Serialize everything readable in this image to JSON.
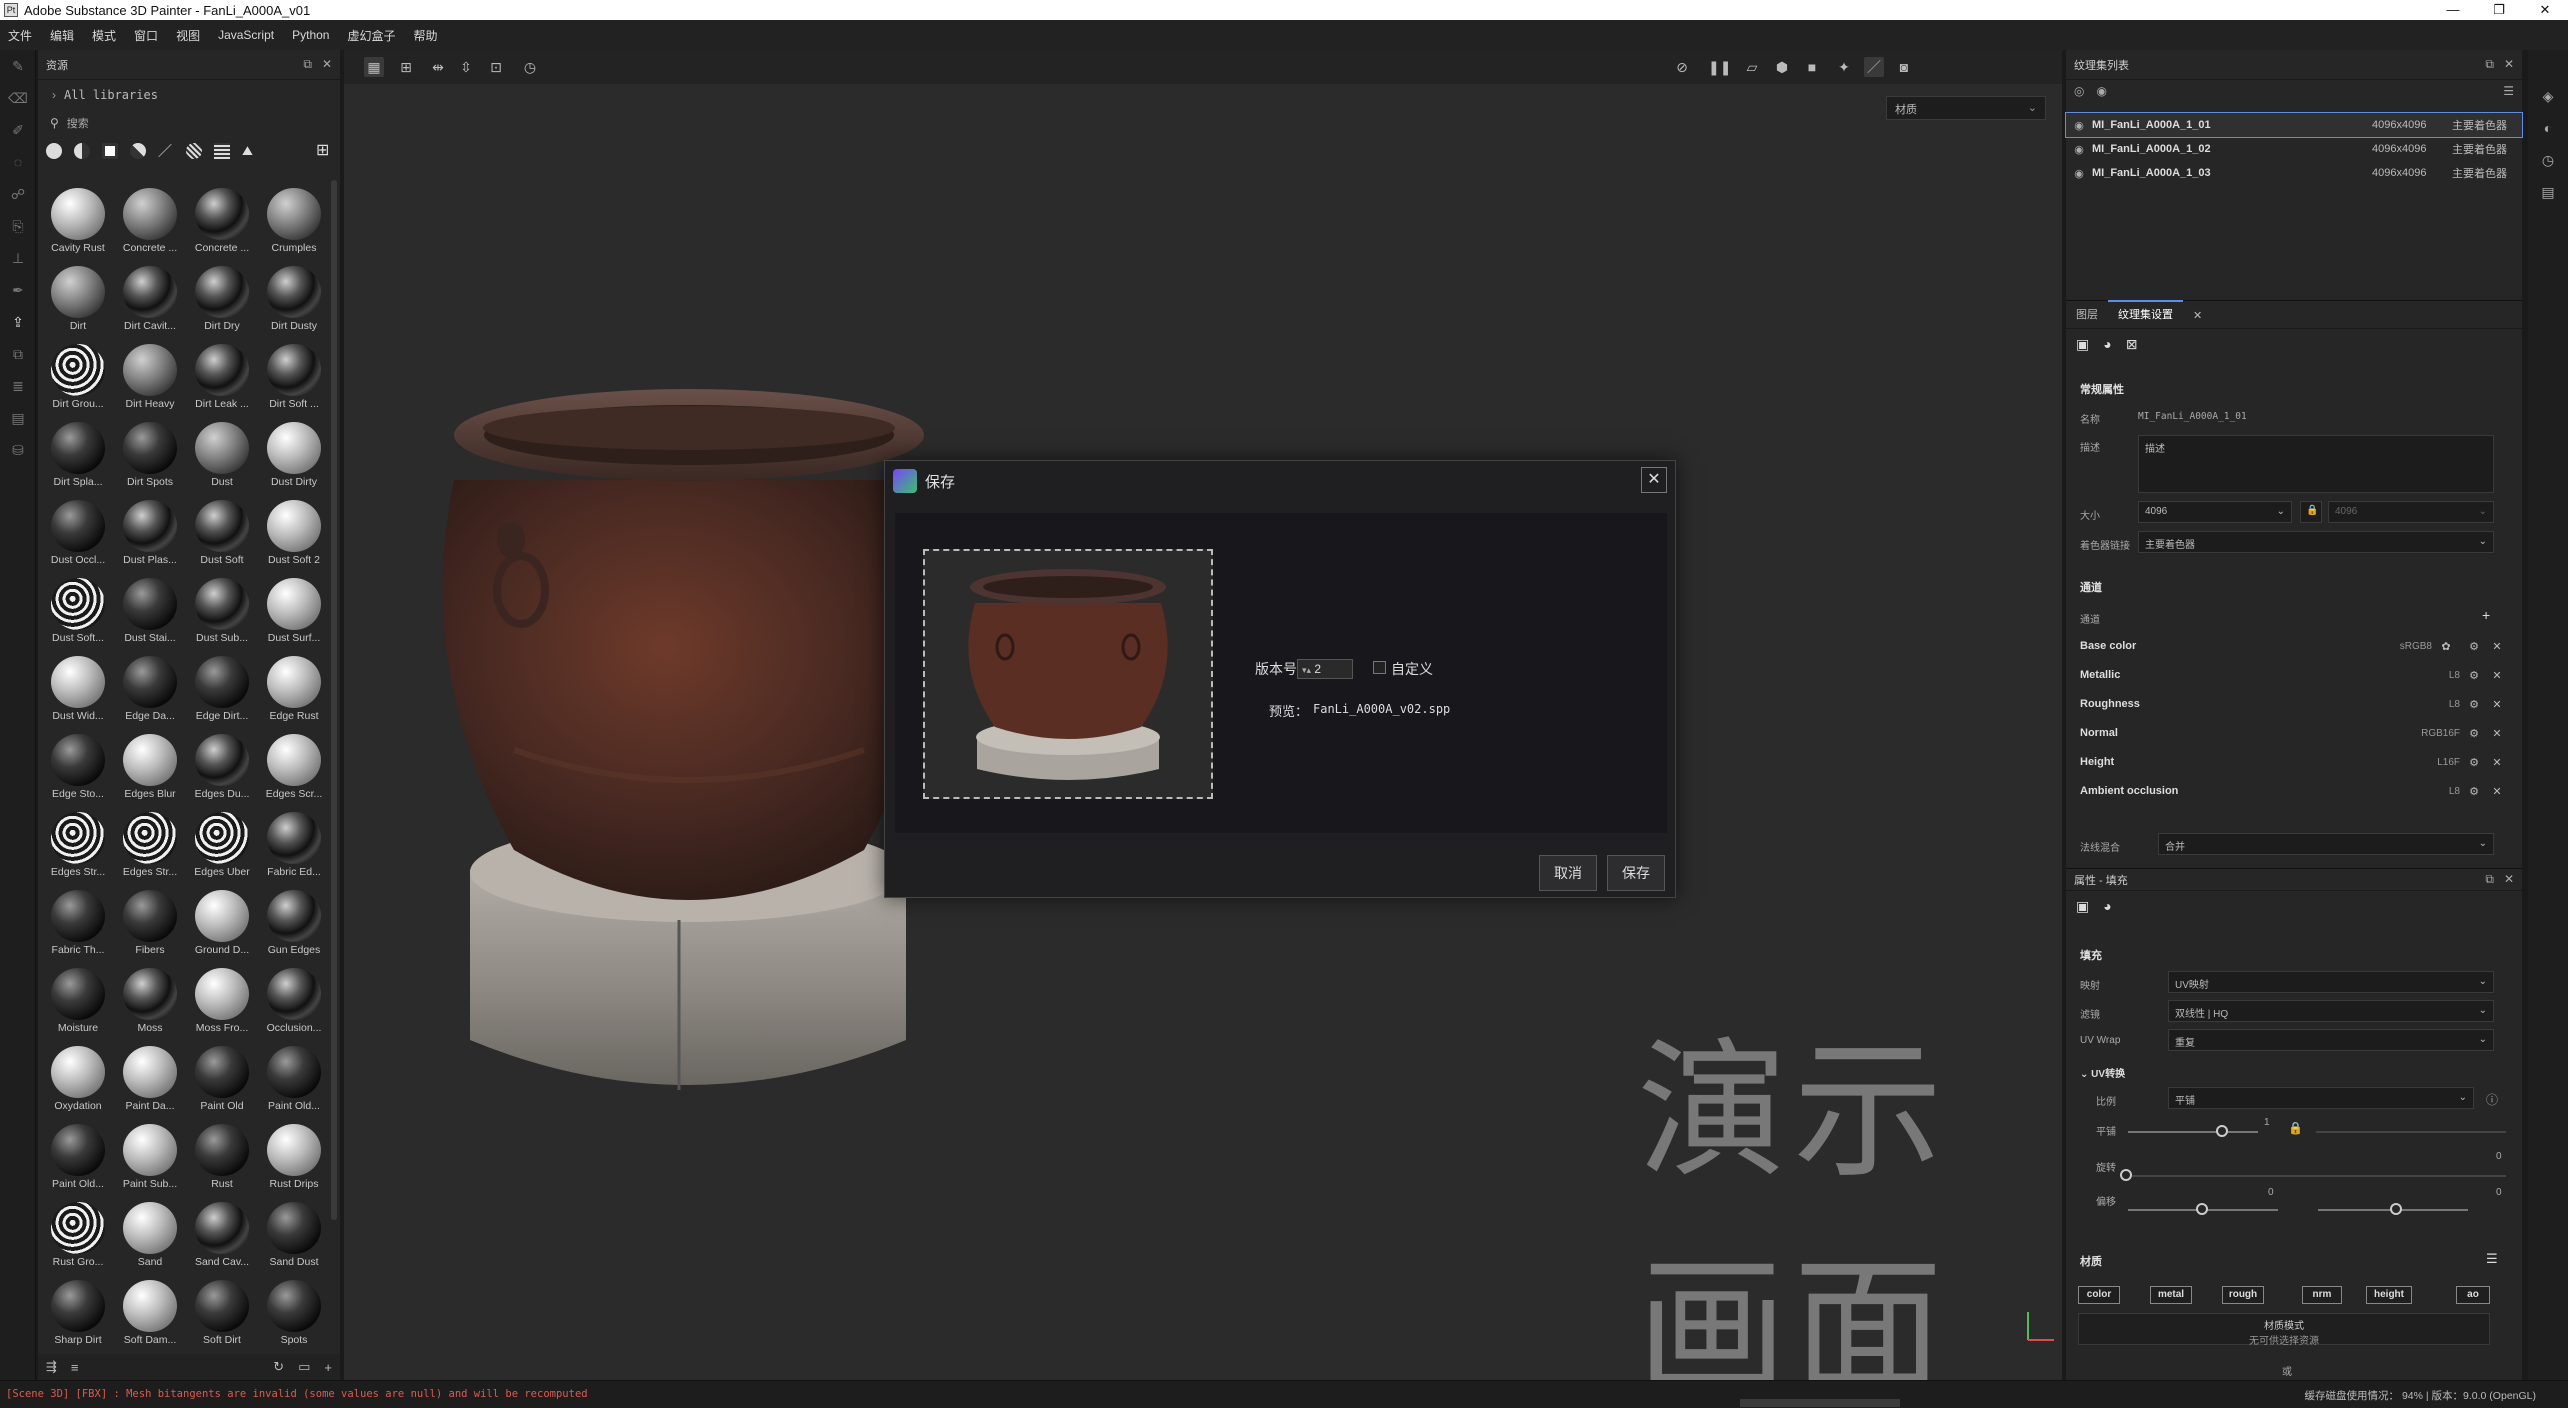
{
  "window": {
    "title": "Adobe Substance 3D Painter - FanLi_A000A_v01",
    "app_icon": "Pt"
  },
  "menu": [
    "文件",
    "编辑",
    "模式",
    "窗口",
    "视图",
    "JavaScript",
    "Python",
    "虚幻盒子",
    "帮助"
  ],
  "assets": {
    "title": "资源",
    "library": "All libraries",
    "search_placeholder": "搜索",
    "materials": [
      {
        "name": "Cavity Rust",
        "tone": "light"
      },
      {
        "name": "Concrete ...",
        "tone": "mid"
      },
      {
        "name": "Concrete ...",
        "tone": "spec"
      },
      {
        "name": "Crumples",
        "tone": "mid"
      },
      {
        "name": "Dirt",
        "tone": "mid"
      },
      {
        "name": "Dirt Cavit...",
        "tone": "spec"
      },
      {
        "name": "Dirt Dry",
        "tone": "spec"
      },
      {
        "name": "Dirt Dusty",
        "tone": "spec"
      },
      {
        "name": "Dirt Grou...",
        "tone": "stripe"
      },
      {
        "name": "Dirt Heavy",
        "tone": "mid"
      },
      {
        "name": "Dirt Leak ...",
        "tone": "spec"
      },
      {
        "name": "Dirt Soft ...",
        "tone": "spec"
      },
      {
        "name": "Dirt Spla...",
        "tone": "dark"
      },
      {
        "name": "Dirt Spots",
        "tone": "dark"
      },
      {
        "name": "Dust",
        "tone": "mid"
      },
      {
        "name": "Dust Dirty",
        "tone": "light"
      },
      {
        "name": "Dust Occl...",
        "tone": "dark"
      },
      {
        "name": "Dust Plas...",
        "tone": "spec"
      },
      {
        "name": "Dust Soft",
        "tone": "spec"
      },
      {
        "name": "Dust Soft 2",
        "tone": "light"
      },
      {
        "name": "Dust Soft...",
        "tone": "stripe"
      },
      {
        "name": "Dust Stai...",
        "tone": "dark"
      },
      {
        "name": "Dust Sub...",
        "tone": "spec"
      },
      {
        "name": "Dust Surf...",
        "tone": "light"
      },
      {
        "name": "Dust Wid...",
        "tone": "light"
      },
      {
        "name": "Edge Da...",
        "tone": "dark"
      },
      {
        "name": "Edge Dirt...",
        "tone": "dark"
      },
      {
        "name": "Edge Rust",
        "tone": "light"
      },
      {
        "name": "Edge Sto...",
        "tone": "dark"
      },
      {
        "name": "Edges Blur",
        "tone": "light"
      },
      {
        "name": "Edges Du...",
        "tone": "spec"
      },
      {
        "name": "Edges Scr...",
        "tone": "light"
      },
      {
        "name": "Edges Str...",
        "tone": "stripe"
      },
      {
        "name": "Edges Str...",
        "tone": "stripe"
      },
      {
        "name": "Edges Uber",
        "tone": "stripe"
      },
      {
        "name": "Fabric Ed...",
        "tone": "spec"
      },
      {
        "name": "Fabric Th...",
        "tone": "dark"
      },
      {
        "name": "Fibers",
        "tone": "dark"
      },
      {
        "name": "Ground D...",
        "tone": "light"
      },
      {
        "name": "Gun Edges",
        "tone": "spec"
      },
      {
        "name": "Moisture",
        "tone": "dark"
      },
      {
        "name": "Moss",
        "tone": "spec"
      },
      {
        "name": "Moss Fro...",
        "tone": "light"
      },
      {
        "name": "Occlusion...",
        "tone": "spec"
      },
      {
        "name": "Oxydation",
        "tone": "light"
      },
      {
        "name": "Paint Da...",
        "tone": "light"
      },
      {
        "name": "Paint Old",
        "tone": "dark"
      },
      {
        "name": "Paint Old...",
        "tone": "dark"
      },
      {
        "name": "Paint Old...",
        "tone": "dark"
      },
      {
        "name": "Paint Sub...",
        "tone": "light"
      },
      {
        "name": "Rust",
        "tone": "dark"
      },
      {
        "name": "Rust Drips",
        "tone": "light"
      },
      {
        "name": "Rust Gro...",
        "tone": "stripe"
      },
      {
        "name": "Sand",
        "tone": "light"
      },
      {
        "name": "Sand Cav...",
        "tone": "spec"
      },
      {
        "name": "Sand Dust",
        "tone": "dark"
      },
      {
        "name": "Sharp Dirt",
        "tone": "dark"
      },
      {
        "name": "Soft Dam...",
        "tone": "light"
      },
      {
        "name": "Soft Dirt",
        "tone": "dark"
      },
      {
        "name": "Spots",
        "tone": "dark"
      }
    ]
  },
  "viewport": {
    "dropdown": "材质",
    "watermark": "演示画面"
  },
  "dialog": {
    "title": "保存",
    "version_label": "版本号：",
    "version_value": "2",
    "custom_label": "自定义",
    "preview_label": "预览：",
    "preview_file": "FanLi_A000A_v02.spp",
    "cancel": "取消",
    "save": "保存"
  },
  "texture_set_list": {
    "title": "纹理集列表",
    "items": [
      {
        "name": "MI_FanLi_A000A_1_01",
        "size": "4096x4096",
        "shader": "主要着色器"
      },
      {
        "name": "MI_FanLi_A000A_1_02",
        "size": "4096x4096",
        "shader": "主要着色器"
      },
      {
        "name": "MI_FanLi_A000A_1_03",
        "size": "4096x4096",
        "shader": "主要着色器"
      }
    ]
  },
  "texture_set_settings": {
    "tabs": [
      "图层",
      "纹理集设置"
    ],
    "section_general": "常规属性",
    "name_label": "名称",
    "name_value": "MI_FanLi_A000A_1_01",
    "desc_label": "描述",
    "desc_placeholder": "描述",
    "size_label": "大小",
    "size_value": "4096",
    "size_value2": "4096",
    "shader_label": "着色器链接",
    "shader_value": "主要着色器",
    "section_channels": "通道",
    "channels_label": "通道",
    "channels": [
      {
        "name": "Base color",
        "format": "sRGB8"
      },
      {
        "name": "Metallic",
        "format": "L8"
      },
      {
        "name": "Roughness",
        "format": "L8"
      },
      {
        "name": "Normal",
        "format": "RGB16F"
      },
      {
        "name": "Height",
        "format": "L16F"
      },
      {
        "name": "Ambient occlusion",
        "format": "L8"
      }
    ],
    "blend_label": "法线混合",
    "blend_value": "合并"
  },
  "properties": {
    "title": "属性 - 填充",
    "section_fill": "填充",
    "mapping_label": "映射",
    "mapping_value": "UV映射",
    "filter_label": "滤镜",
    "filter_value": "双线性 | HQ",
    "uvwrap_label": "UV Wrap",
    "uvwrap_value": "重复",
    "uv_transform": "UV转换",
    "scale_label": "比例",
    "scale_value": "平铺",
    "tile_label": "平铺",
    "tile_value": "1",
    "rotate_label": "旋转",
    "rotate_value": "0",
    "offset_label": "偏移",
    "offset_value": "0",
    "offset_value2": "0",
    "section_material": "材质",
    "channel_buttons": [
      "color",
      "metal",
      "rough",
      "nrm",
      "height",
      "ao"
    ],
    "material_mode": "材质模式",
    "material_mode_note": "无可供选择资源",
    "footer_char": "或"
  },
  "status": {
    "message": "[Scene 3D] [FBX] : Mesh bitangents are invalid (some values are null) and will be recomputed",
    "right": "缓存磁盘使用情况： 94% | 版本：9.0.0 (OpenGL)"
  }
}
